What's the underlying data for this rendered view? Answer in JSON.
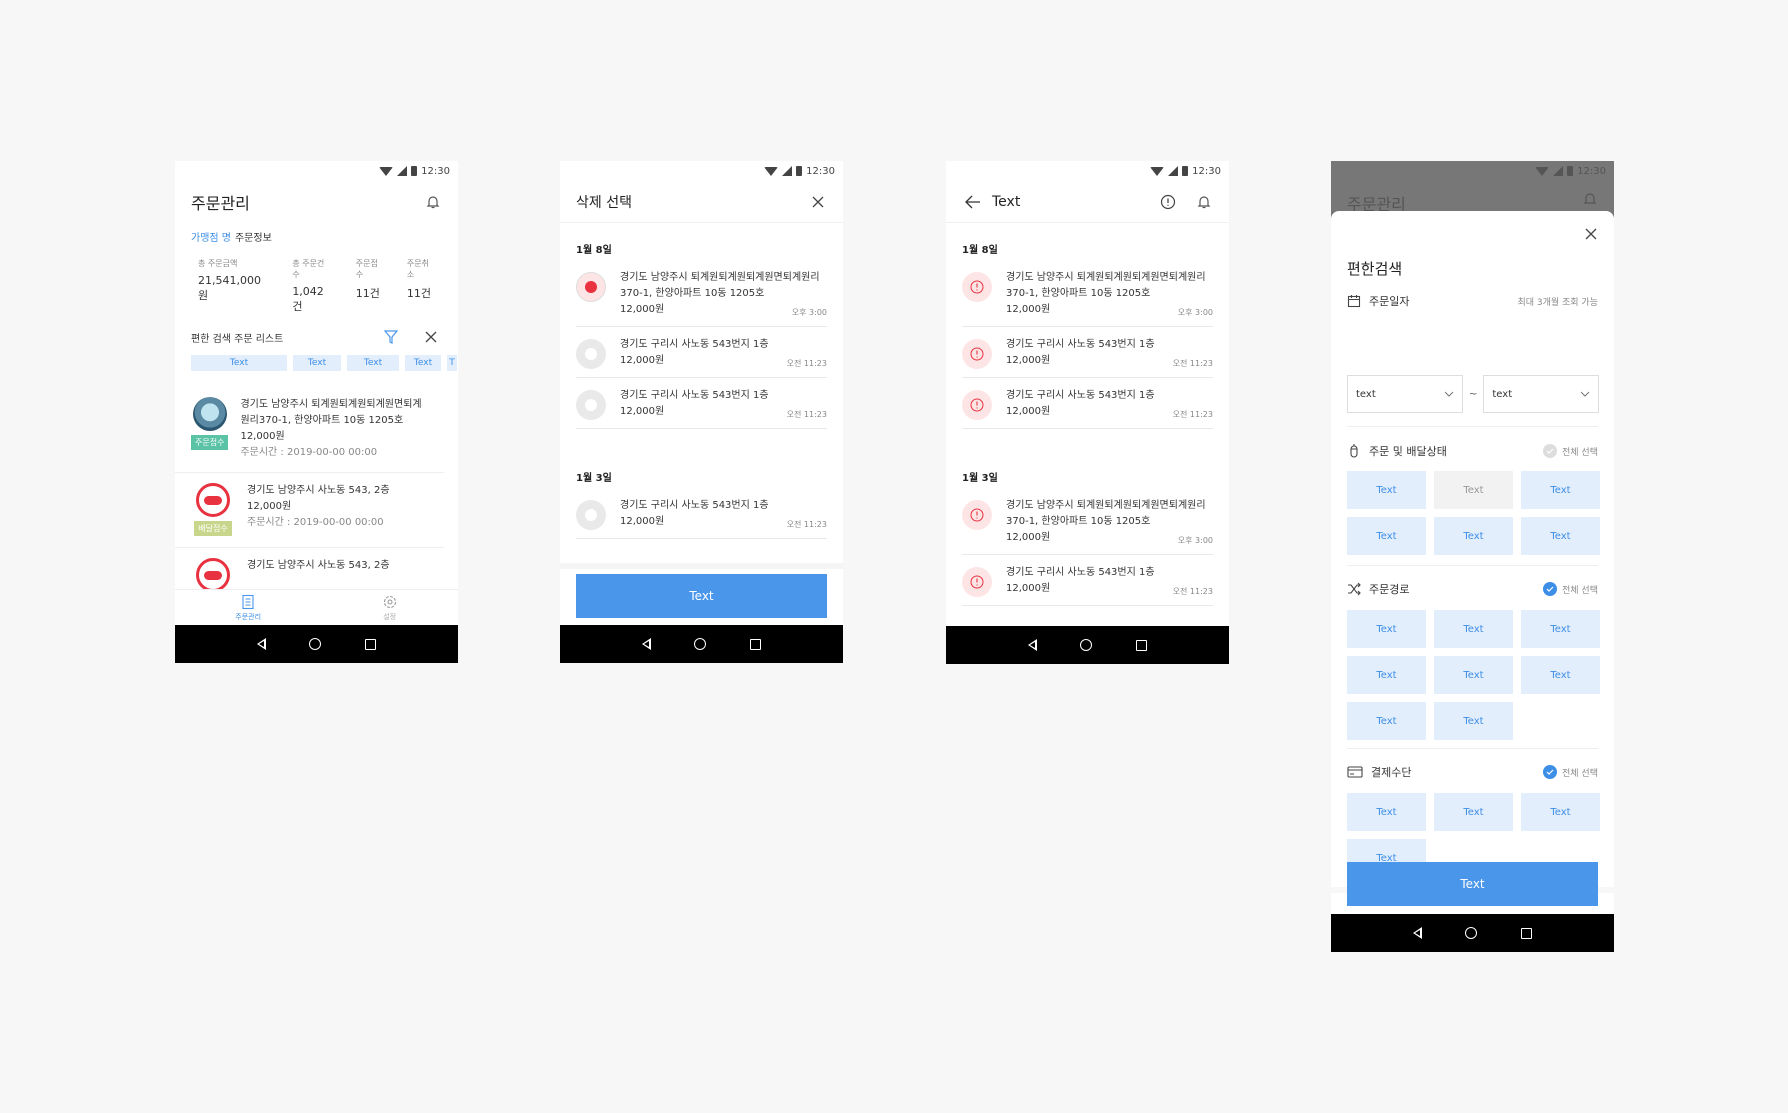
{
  "status": {
    "time": "12:30"
  },
  "screen1": {
    "title": "주문관리",
    "store_name": "가맹점 명",
    "store_suffix": "주문정보",
    "stats": [
      {
        "label": "총 주문금액",
        "value": "21,541,000원"
      },
      {
        "label": "총 주문건 수",
        "value": "1,042건"
      },
      {
        "label": "주문접수",
        "value": "11건"
      },
      {
        "label": "주문취소",
        "value": "11건"
      }
    ],
    "list_title": "편한 검색 주문 리스트",
    "chips": [
      "Text",
      "Text",
      "Text",
      "Text",
      "T"
    ],
    "orders": [
      {
        "address": "경기도 남양주시 퇴계원퇴계원퇴계원면퇴계원리370-1, 한양아파트 10동 1205호",
        "price": "12,000원",
        "time": "주문시간 : 2019-00-00 00:00",
        "tag": "주문접수"
      },
      {
        "address": "경기도 남양주시 사노동 543, 2층",
        "price": "12,000원",
        "time": "주문시간 : 2019-00-00 00:00",
        "tag": "배달접수"
      },
      {
        "address": "경기도 남양주시 사노동 543, 2층"
      }
    ],
    "tabs": [
      {
        "label": "주문관리",
        "icon": "document-icon"
      },
      {
        "label": "설정",
        "icon": "gear-icon"
      }
    ]
  },
  "screen2": {
    "title": "삭제 선택",
    "groups": [
      {
        "date": "1월 8일",
        "items": [
          {
            "address": "경기도 남양주시 퇴계원퇴계원퇴계원면퇴계원리370-1, 한양아파트 10동 1205호",
            "price": "12,000원",
            "time": "오후 3:00",
            "selected": true
          },
          {
            "address": "경기도 구리시 사노동 543번지 1층",
            "price": "12,000원",
            "time": "오전 11:23"
          },
          {
            "address": "경기도 구리시 사노동 543번지 1층",
            "price": "12,000원",
            "time": "오전 11:23"
          }
        ]
      },
      {
        "date": "1월 3일",
        "items": [
          {
            "address": "경기도 구리시 사노동 543번지 1층",
            "price": "12,000원",
            "time": "오전 11:23"
          }
        ]
      }
    ],
    "button": "Text"
  },
  "screen3": {
    "title": "Text",
    "groups": [
      {
        "date": "1월 8일",
        "items": [
          {
            "address": "경기도 남양주시 퇴계원퇴계원퇴계원면퇴계원리370-1, 한양아파트 10동 1205호",
            "price": "12,000원",
            "time": "오후 3:00"
          },
          {
            "address": "경기도 구리시 사노동 543번지 1층",
            "price": "12,000원",
            "time": "오전 11:23"
          },
          {
            "address": "경기도 구리시 사노동 543번지 1층",
            "price": "12,000원",
            "time": "오전 11:23"
          }
        ]
      },
      {
        "date": "1월 3일",
        "items": [
          {
            "address": "경기도 남양주시 퇴계원퇴계원퇴계원면퇴계원리370-1, 한양아파트 10동 1205호",
            "price": "12,000원",
            "time": "오후 3:00"
          },
          {
            "address": "경기도 구리시 사노동 543번지 1층",
            "price": "12,000원",
            "time": "오전 11:23"
          }
        ]
      }
    ]
  },
  "screen4": {
    "bg_title": "주문관리",
    "title": "편한검색",
    "date_section": {
      "label": "주문일자",
      "note": "최대 3개월 조회 가능",
      "from": "text",
      "to": "text",
      "sep": "~"
    },
    "status_section": {
      "label": "주문 및 배달상태",
      "select_all": "전체 선택",
      "options": [
        "Text",
        "Text",
        "Text",
        "Text",
        "Text",
        "Text"
      ]
    },
    "route_section": {
      "label": "주문경로",
      "select_all": "전체 선택",
      "options": [
        "Text",
        "Text",
        "Text",
        "Text",
        "Text",
        "Text",
        "Text",
        "Text"
      ]
    },
    "payment_section": {
      "label": "결제수단",
      "select_all": "전체 선택",
      "options": [
        "Text",
        "Text",
        "Text",
        "Text"
      ]
    },
    "button": "Text"
  },
  "colors": {
    "accent": "#4a96ea",
    "chip_bg": "#e3eefc",
    "alert_red": "#e8323f"
  }
}
